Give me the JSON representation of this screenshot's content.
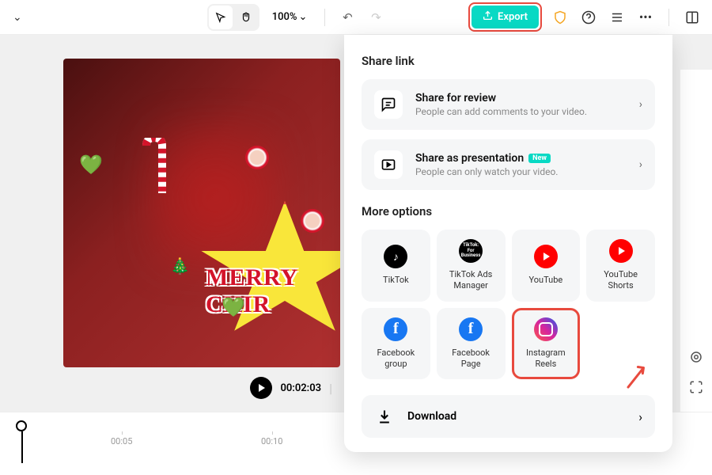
{
  "toolbar": {
    "zoom": "100%",
    "export_label": "Export"
  },
  "preview": {
    "overlay_text": "MERRY CHIR",
    "current_time": "00:02:03",
    "separator": "|"
  },
  "timeline": {
    "tick1": "00:05",
    "tick2": "00:10"
  },
  "panel": {
    "share_heading": "Share link",
    "review": {
      "title": "Share for review",
      "subtitle": "People can add comments to your video."
    },
    "presentation": {
      "title": "Share as presentation",
      "subtitle": "People can only watch your video.",
      "badge": "New"
    },
    "more_heading": "More options",
    "options": [
      {
        "label": "TikTok"
      },
      {
        "label": "TikTok Ads Manager"
      },
      {
        "label": "YouTube"
      },
      {
        "label": "YouTube Shorts"
      },
      {
        "label": "Facebook group"
      },
      {
        "label": "Facebook Page"
      },
      {
        "label": "Instagram Reels"
      }
    ],
    "download_label": "Download"
  },
  "annotations": {
    "export_highlight_color": "#e84a3e",
    "instagram_highlight_color": "#e84a3e"
  }
}
